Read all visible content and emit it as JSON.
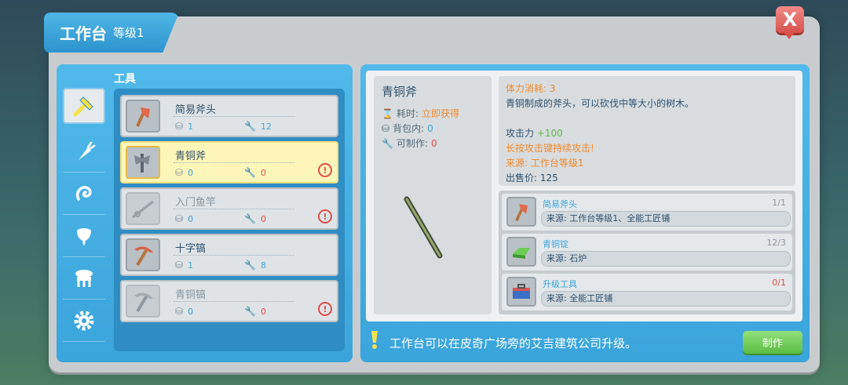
{
  "window": {
    "title": "工作台",
    "level": "等级1",
    "close_label": "X"
  },
  "left": {
    "section_label": "工具",
    "categories": [
      {
        "icon": "tool-icon"
      },
      {
        "icon": "carrot-icon"
      },
      {
        "icon": "spiral-icon"
      },
      {
        "icon": "shield-icon"
      },
      {
        "icon": "furniture-icon"
      },
      {
        "icon": "gear-icon"
      }
    ],
    "items": [
      {
        "name": "简易斧头",
        "bag": "1",
        "craftable": "12",
        "warning": false
      },
      {
        "name": "青铜斧",
        "bag": "0",
        "craftable": "0",
        "warning": true
      },
      {
        "name": "入门鱼竿",
        "bag": "0",
        "craftable": "0",
        "warning": true
      },
      {
        "name": "十字镐",
        "bag": "1",
        "craftable": "8",
        "warning": false
      },
      {
        "name": "青铜镐",
        "bag": "0",
        "craftable": "0",
        "warning": true
      }
    ]
  },
  "detail": {
    "name": "青铜斧",
    "time_label": "耗时:",
    "time_value": "立即获得",
    "bag_label": "背包内:",
    "bag_value": "0",
    "craft_label": "可制作:",
    "craft_value": "0",
    "stamina": "体力消耗: 3",
    "desc": "青铜制成的斧头，可以砍伐中等大小的树木。",
    "attack_label": "攻击力",
    "attack_value": "+100",
    "hold_tip": "长按攻击键持续攻击!",
    "source": "来源: 工作台等级1",
    "price": "出售价: 125"
  },
  "materials": [
    {
      "name": "简易斧头",
      "count": "1/1",
      "source": "来源: 工作台等级1、全能工匠铺",
      "short": false
    },
    {
      "name": "青铜锭",
      "count": "12/3",
      "source": "来源: 石炉",
      "short": false
    },
    {
      "name": "升级工具",
      "count": "0/1",
      "source": "来源: 全能工匠铺",
      "short": true
    }
  ],
  "footer": {
    "hint": "工作台可以在皮奇广场旁的艾吉建筑公司升级。",
    "make_label": "制作"
  },
  "colors": {
    "accent": "#3aa4dc",
    "warning": "#e24d4d",
    "orange": "#f08a2c",
    "green": "#5cbd43"
  }
}
